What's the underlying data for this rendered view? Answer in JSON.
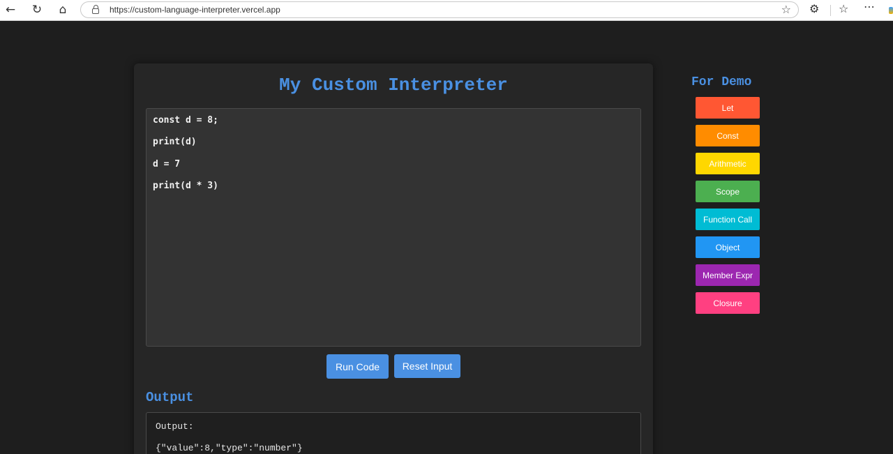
{
  "browser": {
    "url": "https://custom-language-interpreter.vercel.app",
    "back_icon": "arrow-left-icon",
    "reload_icon": "reload-icon",
    "home_icon": "home-icon"
  },
  "app": {
    "title": "My Custom Interpreter",
    "code_lines": [
      "const d = 8;",
      "print(d)",
      "d = 7",
      "print(d * 3)"
    ],
    "run_label": "Run Code",
    "reset_label": "Reset Input",
    "output_heading": "Output",
    "output_lines": [
      "Output:",
      "{\"value\":8,\"type\":\"number\"}"
    ],
    "accent_color": "#4a90e2"
  },
  "demo": {
    "title": "For Demo",
    "buttons": [
      {
        "label": "Let",
        "color": "#ff5733"
      },
      {
        "label": "Const",
        "color": "#ff8c00"
      },
      {
        "label": "Arithmetic",
        "color": "#ffd700"
      },
      {
        "label": "Scope",
        "color": "#4caf50"
      },
      {
        "label": "Function Call",
        "color": "#00bcd4"
      },
      {
        "label": "Object",
        "color": "#2196f3"
      },
      {
        "label": "Member Expr",
        "color": "#9c27b0"
      },
      {
        "label": "Closure",
        "color": "#ff4081"
      }
    ]
  }
}
